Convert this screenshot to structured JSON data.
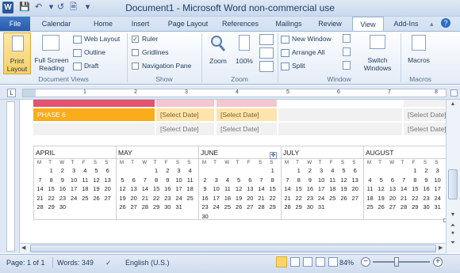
{
  "window": {
    "title": "Document1 - Microsoft Word non-commercial use",
    "app_logo": "W"
  },
  "qat": {
    "icons": [
      "save-icon",
      "undo-icon",
      "redo-icon",
      "new-document-icon",
      "customize-icon"
    ]
  },
  "tabs": [
    "File",
    "Calendar",
    "Home",
    "Insert",
    "Page Layout",
    "References",
    "Mailings",
    "Review",
    "View",
    "Add-Ins"
  ],
  "active_tab": "View",
  "ribbon": {
    "document_views": {
      "label": "Document Views",
      "print_layout": "Print Layout",
      "full_screen": "Full Screen Reading",
      "web_layout": "Web Layout",
      "outline": "Outline",
      "draft": "Draft"
    },
    "show": {
      "label": "Show",
      "ruler": "Ruler",
      "gridlines": "Gridlines",
      "navigation_pane": "Navigation Pane",
      "ruler_checked": true
    },
    "zoom": {
      "label": "Zoom",
      "zoom": "Zoom",
      "percent": "100%"
    },
    "window": {
      "label": "Window",
      "new_window": "New Window",
      "arrange_all": "Arrange All",
      "split": "Split",
      "switch_windows": "Switch Windows"
    },
    "macros": {
      "label": "Macros",
      "macros": "Macros"
    }
  },
  "ruler": {
    "numbers": [
      "1",
      "2",
      "3",
      "4",
      "5",
      "6",
      "7",
      "8"
    ]
  },
  "phases": {
    "phase6": "PHASE 6",
    "select_date": "[Select Date]",
    "colors": {
      "pink": "#e2536f",
      "pink_light": "#f4c7d0",
      "orange": "#fbac19",
      "orange_light": "#fde4ad",
      "grey": "#f1f1f1"
    }
  },
  "calendar": {
    "weekdays": [
      "M",
      "T",
      "W",
      "T",
      "F",
      "S",
      "S"
    ],
    "months": [
      {
        "name": "APRIL",
        "rows": [
          [
            "",
            "1",
            "2",
            "3",
            "4",
            "5",
            "6"
          ],
          [
            "7",
            "8",
            "9",
            "10",
            "11",
            "12",
            "13"
          ],
          [
            "14",
            "15",
            "16",
            "17",
            "18",
            "19",
            "20"
          ],
          [
            "21",
            "22",
            "23",
            "24",
            "25",
            "26",
            "27"
          ],
          [
            "28",
            "29",
            "30",
            "",
            "",
            "",
            ""
          ]
        ]
      },
      {
        "name": "MAY",
        "rows": [
          [
            "",
            "",
            "",
            "1",
            "2",
            "3",
            "4"
          ],
          [
            "5",
            "6",
            "7",
            "8",
            "9",
            "10",
            "11"
          ],
          [
            "12",
            "13",
            "14",
            "15",
            "16",
            "17",
            "18"
          ],
          [
            "19",
            "20",
            "21",
            "22",
            "23",
            "24",
            "25"
          ],
          [
            "26",
            "27",
            "28",
            "29",
            "30",
            "31",
            ""
          ]
        ]
      },
      {
        "name": "JUNE",
        "rows": [
          [
            "",
            "",
            "",
            "",
            "",
            "",
            "1"
          ],
          [
            "2",
            "3",
            "4",
            "5",
            "6",
            "7",
            "8"
          ],
          [
            "9",
            "10",
            "11",
            "12",
            "13",
            "14",
            "15"
          ],
          [
            "16",
            "17",
            "18",
            "19",
            "20",
            "21",
            "22"
          ],
          [
            "23",
            "24",
            "25",
            "26",
            "27",
            "28",
            "29"
          ],
          [
            "30",
            "",
            "",
            "",
            "",
            "",
            ""
          ]
        ]
      },
      {
        "name": "JULY",
        "rows": [
          [
            "",
            "1",
            "2",
            "3",
            "4",
            "5",
            "6"
          ],
          [
            "7",
            "8",
            "9",
            "10",
            "11",
            "12",
            "13"
          ],
          [
            "14",
            "15",
            "16",
            "17",
            "18",
            "19",
            "20"
          ],
          [
            "21",
            "22",
            "23",
            "24",
            "25",
            "26",
            "27"
          ],
          [
            "28",
            "29",
            "30",
            "31",
            "",
            "",
            ""
          ]
        ]
      },
      {
        "name": "AUGUST",
        "rows": [
          [
            "",
            "",
            "",
            "",
            "1",
            "2",
            "3"
          ],
          [
            "4",
            "5",
            "6",
            "7",
            "8",
            "9",
            "10"
          ],
          [
            "11",
            "12",
            "13",
            "14",
            "15",
            "16",
            "17"
          ],
          [
            "18",
            "19",
            "20",
            "21",
            "22",
            "23",
            "24"
          ],
          [
            "25",
            "26",
            "27",
            "28",
            "29",
            "30",
            "31"
          ]
        ]
      }
    ]
  },
  "status": {
    "page": "Page: 1 of 1",
    "words": "Words: 349",
    "language": "English (U.S.)",
    "zoom": "84%",
    "minus": "−",
    "plus": "+",
    "zoom_level": 0.84
  }
}
